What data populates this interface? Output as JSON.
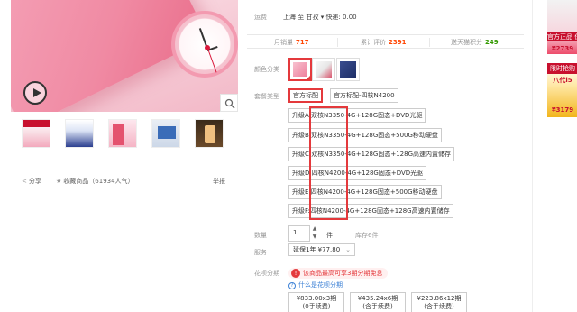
{
  "gallery": {
    "thumbs": [
      "thumb-1",
      "thumb-2",
      "thumb-3",
      "thumb-4",
      "thumb-5"
    ]
  },
  "actions": {
    "share": "分享",
    "favorite": "收藏商品",
    "popularity": "（61934人气）",
    "report": "举报"
  },
  "delivery": {
    "label": "运费",
    "from": "上海",
    "to_word": "至",
    "dest": "甘孜",
    "fee": "快递: 0.00"
  },
  "stats": {
    "monthly_sales_label": "月销量",
    "monthly_sales": "717",
    "reviews_label": "累计评价",
    "reviews": "2391",
    "points_label": "送天猫积分",
    "points": "249"
  },
  "color": {
    "label": "颜色分类",
    "swatches": [
      "pink",
      "pink-white",
      "navy"
    ],
    "selected_index": 0
  },
  "package": {
    "label": "套餐类型",
    "options": [
      "官方标配",
      "官方标配-四核N4200"
    ],
    "selected_index": 0,
    "upgrades": [
      "升级A:双核N3350-4G+128G固态+DVD光驱",
      "升级B:双核N3350-4G+128G固态+500G移动硬盘",
      "升级C:双核N3350-4G+128G固态+128G高速内置储存",
      "升级D:四核N4200-4G+128G固态+DVD光驱",
      "升级E:四核N4200-4G+128G固态+500G移动硬盘",
      "升级F:四核N4200-4G+128G固态+128G高速内置储存"
    ]
  },
  "quantity": {
    "label": "数量",
    "value": "1",
    "unit": "件",
    "stock": "库存6件"
  },
  "service": {
    "label": "服务",
    "value": "延保1年 ¥77.80"
  },
  "installment": {
    "label": "花呗分期",
    "notice": "该商品最高可享3期分期免息",
    "what": "什么是花呗分期",
    "plans": [
      {
        "amount": "¥833.00x3期",
        "fee": "(0手续费)"
      },
      {
        "amount": "¥435.24x6期",
        "fee": "(含手续费)"
      },
      {
        "amount": "¥223.86x12期",
        "fee": "(含手续费)"
      }
    ]
  },
  "side_ads": {
    "ad1_tag": "官方正品 保",
    "ad1_price": "¥2739",
    "ad2_head": "限时抢购",
    "ad2_title": "八代i5",
    "ad2_price": "¥3179"
  },
  "colors": {
    "accent_red": "#e4393c",
    "price_orange": "#ff4400",
    "points_green": "#339900",
    "link_blue": "#3c81d6"
  }
}
